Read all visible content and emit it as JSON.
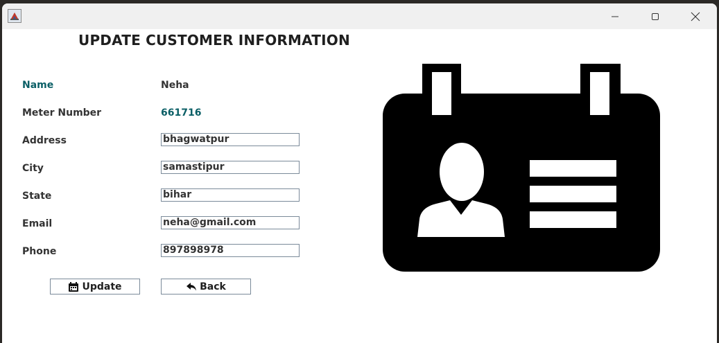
{
  "window": {
    "title": "",
    "controls": [
      "minimize",
      "maximize",
      "close"
    ]
  },
  "form": {
    "heading": "UPDATE CUSTOMER INFORMATION",
    "name_label": "Name",
    "name_value": "Neha",
    "meter_label": "Meter Number",
    "meter_value": "661716",
    "address_label": "Address",
    "address_value": "bhagwatpur",
    "city_label": "City",
    "city_value": "samastipur",
    "state_label": "State",
    "state_value": "bihar",
    "email_label": "Email",
    "email_value": "neha@gmail.com",
    "phone_label": "Phone",
    "phone_value": "897898978"
  },
  "buttons": {
    "update_label": "Update",
    "update_icon": "calendar-icon",
    "back_label": "Back",
    "back_icon": "reply-arrow-icon"
  },
  "illustration": {
    "icon": "id-badge-icon"
  },
  "colors": {
    "accent_teal": "#0b5f66",
    "text": "#333333"
  }
}
